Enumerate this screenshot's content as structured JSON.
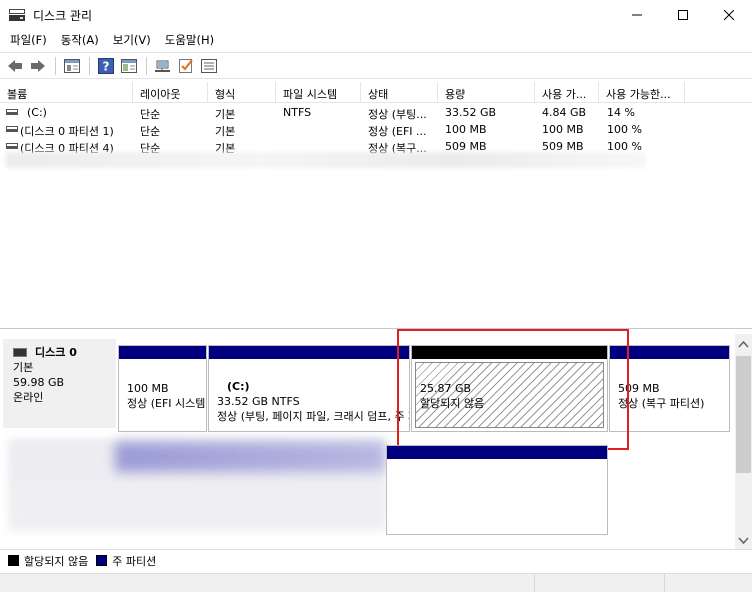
{
  "window": {
    "title": "디스크 관리"
  },
  "menu": [
    "파일(F)",
    "동작(A)",
    "보기(V)",
    "도움말(H)"
  ],
  "toolbar_icons": [
    "back-icon",
    "forward-icon",
    "properties-icon",
    "help-icon",
    "console-tree-icon",
    "connect-icon",
    "check-icon",
    "list-icon"
  ],
  "list": {
    "columns": [
      "볼륨",
      "레이아웃",
      "형식",
      "파일 시스템",
      "상태",
      "용량",
      "사용 가...",
      "사용 가능한..."
    ],
    "rows": [
      [
        "(C:)",
        "단순",
        "기본",
        "NTFS",
        "정상 (부팅...",
        "33.52 GB",
        "4.84 GB",
        "14 %"
      ],
      [
        "(디스크 0 파티션 1)",
        "단순",
        "기본",
        "",
        "정상 (EFI ...",
        "100 MB",
        "100 MB",
        "100 %"
      ],
      [
        "(디스크 0 파티션 4)",
        "단순",
        "기본",
        "",
        "정상 (복구...",
        "509 MB",
        "509 MB",
        "100 %"
      ]
    ]
  },
  "disk": {
    "name": "디스크 0",
    "type": "기본",
    "size": "59.98 GB",
    "status": "온라인",
    "partitions": [
      {
        "title": "",
        "size": "100 MB",
        "status": "정상 (EFI 시스템 파티션)"
      },
      {
        "title": "(C:)",
        "size": "33.52 GB NTFS",
        "status": "정상 (부팅, 페이지 파일, 크래시 덤프, 주 파티션)"
      },
      {
        "title": "",
        "size": "25.87 GB",
        "status": "할당되지 않음"
      },
      {
        "title": "",
        "size": "509 MB",
        "status": "정상 (복구 파티션)"
      }
    ]
  },
  "legend": {
    "unallocated": "할당되지 않음",
    "primary": "주 파티션"
  },
  "colors": {
    "primary": "#00007f",
    "unallocated": "#000000",
    "highlight": "#e02020"
  }
}
